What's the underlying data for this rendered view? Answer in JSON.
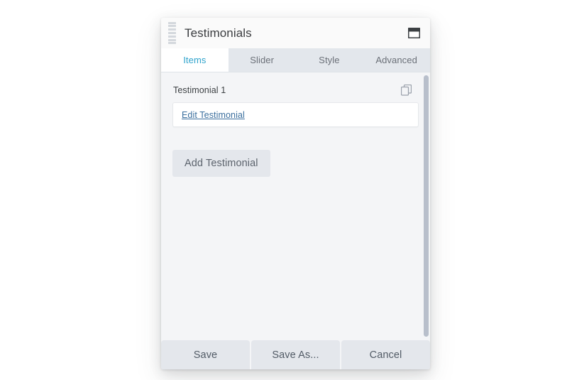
{
  "window": {
    "title": "Testimonials",
    "drag_handle_icon": "drag-handle-icon",
    "window_icon": "window-restore-icon"
  },
  "tabs": [
    {
      "label": "Items",
      "active": true
    },
    {
      "label": "Slider",
      "active": false
    },
    {
      "label": "Style",
      "active": false
    },
    {
      "label": "Advanced",
      "active": false
    }
  ],
  "content": {
    "items": [
      {
        "label": "Testimonial 1",
        "duplicate_icon": "copy-icon",
        "edit_link": "Edit Testimonial"
      }
    ],
    "add_button": "Add Testimonial"
  },
  "footer": {
    "save": "Save",
    "save_as": "Save As...",
    "cancel": "Cancel"
  },
  "colors": {
    "accent": "#2fa3cc",
    "link": "#3b6f9e",
    "panel_bg": "#f4f5f7",
    "titlebar_bg": "#fafafa",
    "tabbar_bg": "#e3e7ec",
    "button_bg": "#e4e7ec",
    "scrollbar_thumb": "#b8bfcb"
  }
}
